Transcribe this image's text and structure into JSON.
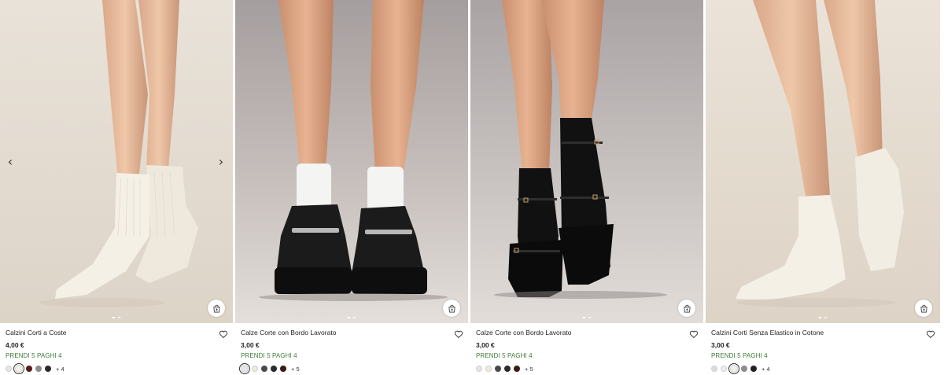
{
  "products": [
    {
      "name": "Calzini Corti a Coste",
      "price": "4,00 €",
      "promo": "PRENDI 5 PAGHI 4",
      "swatches": [
        "#e8e6e2",
        "#f4efe6",
        "#5a1a1a",
        "#8c8c8c",
        "#2a2a2a"
      ],
      "more": "+ 4",
      "prev_icon": "chevron-left-icon",
      "next_icon": "chevron-right-icon"
    },
    {
      "name": "Calze Corte con Bordo Lavorato",
      "price": "3,00 €",
      "promo": "PRENDI 5 PAGHI 4",
      "swatches": [
        "#e6e6e6",
        "#f2ead8",
        "#4a4a4a",
        "#2b2b2b",
        "#3a1a14"
      ],
      "more": "+ 5"
    },
    {
      "name": "Calze Corte con Bordo Lavorato",
      "price": "3,00 €",
      "promo": "PRENDI 5 PAGHI 4",
      "swatches": [
        "#e6e6e6",
        "#f2ead8",
        "#4a4a4a",
        "#2b2b2b",
        "#3a1a14"
      ],
      "more": "+ 5"
    },
    {
      "name": "Calzini Corti Senza Elastico in Cotone",
      "price": "3,00 €",
      "promo": "PRENDI 5 PAGHI 4",
      "swatches": [
        "#dcdcdc",
        "#eeeeee",
        "#f4efe6",
        "#8c8c8c",
        "#222222"
      ],
      "more": "+ 4"
    }
  ],
  "colors": {
    "promo": "#3f7a3a",
    "background": "#ffffff"
  }
}
